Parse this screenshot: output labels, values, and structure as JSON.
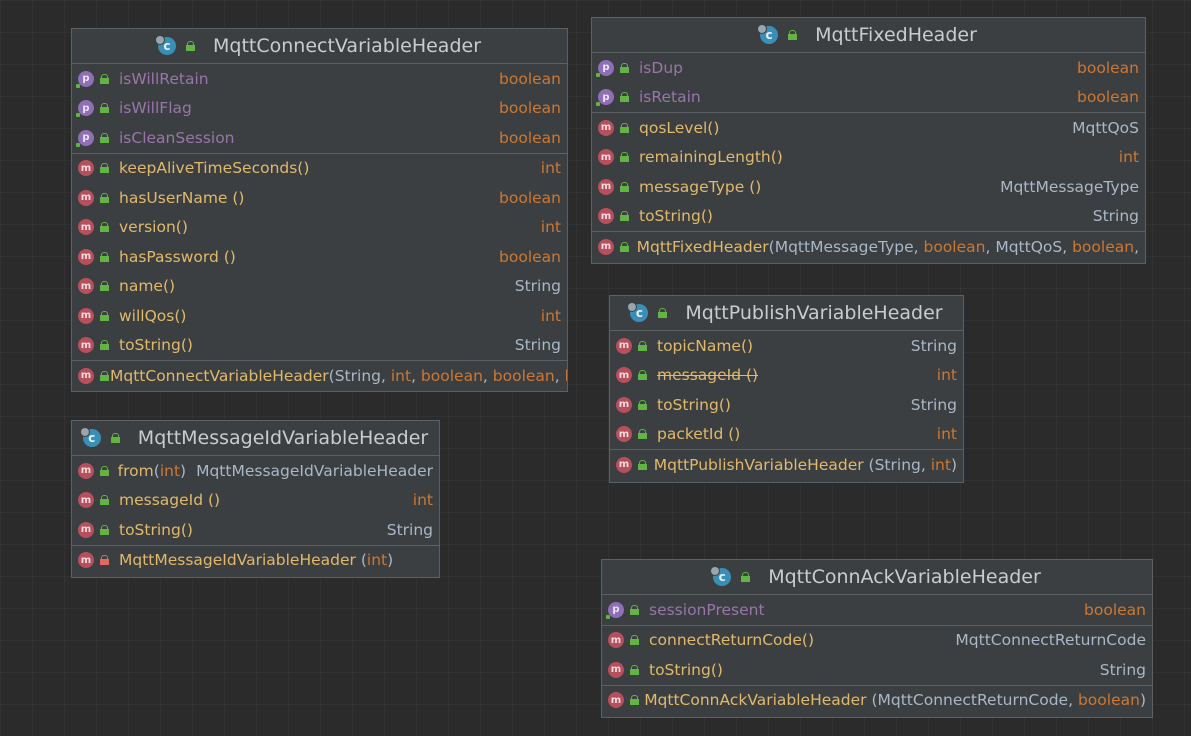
{
  "classes": {
    "connect": {
      "name": "MqttConnectVariableHeader",
      "fields": [
        {
          "name": "isWillRetain",
          "type": "boolean"
        },
        {
          "name": "isWillFlag",
          "type": "boolean"
        },
        {
          "name": "isCleanSession",
          "type": "boolean"
        }
      ],
      "methods": [
        {
          "name": "keepAliveTimeSeconds()",
          "type": "int"
        },
        {
          "name": "hasUserName ()",
          "type": "boolean"
        },
        {
          "name": "version()",
          "type": "int"
        },
        {
          "name": "hasPassword ()",
          "type": "boolean"
        },
        {
          "name": "name()",
          "type": "String"
        },
        {
          "name": "willQos()",
          "type": "int"
        },
        {
          "name": "toString()",
          "type": "String"
        }
      ],
      "ctor": {
        "name": "MqttConnectVariableHeader",
        "params": [
          "String",
          "int",
          "boolean",
          "boolean",
          "b"
        ]
      }
    },
    "fixed": {
      "name": "MqttFixedHeader",
      "fields": [
        {
          "name": "isDup",
          "type": "boolean"
        },
        {
          "name": "isRetain",
          "type": "boolean"
        }
      ],
      "methods": [
        {
          "name": "qosLevel()",
          "type": "MqttQoS"
        },
        {
          "name": "remainingLength()",
          "type": "int"
        },
        {
          "name": "messageType ()",
          "type": "MqttMessageType"
        },
        {
          "name": "toString()",
          "type": "String"
        }
      ],
      "ctor": {
        "name": "MqttFixedHeader",
        "params": [
          "MqttMessageType",
          "boolean",
          "MqttQoS",
          "boolean"
        ]
      }
    },
    "publish": {
      "name": "MqttPublishVariableHeader",
      "methods": [
        {
          "name": "topicName()",
          "type": "String"
        },
        {
          "name": "messageId ()",
          "type": "int"
        },
        {
          "name": "toString()",
          "type": "String"
        },
        {
          "name": "packetId ()",
          "type": "int"
        }
      ],
      "ctor": {
        "name": "MqttPublishVariableHeader",
        "params": [
          "String",
          "int"
        ]
      }
    },
    "messageId": {
      "name": "MqttMessageIdVariableHeader",
      "methods": [
        {
          "name": "from",
          "arg": "int",
          "type": "MqttMessageIdVariableHeader"
        },
        {
          "name": "messageId ()",
          "type": "int"
        },
        {
          "name": "toString()",
          "type": "String"
        }
      ],
      "ctor": {
        "name": "MqttMessageIdVariableHeader",
        "params": [
          "int"
        ]
      }
    },
    "connAck": {
      "name": "MqttConnAckVariableHeader",
      "fields": [
        {
          "name": "sessionPresent",
          "type": "boolean"
        }
      ],
      "methods": [
        {
          "name": "connectReturnCode()",
          "type": "MqttConnectReturnCode"
        },
        {
          "name": "toString()",
          "type": "String"
        }
      ],
      "ctor": {
        "name": "MqttConnAckVariableHeader",
        "params": [
          "MqttConnectReturnCode",
          "boolean"
        ]
      }
    }
  },
  "icons": {
    "method": "m",
    "property": "p",
    "class": "c"
  },
  "colors": {
    "background": "#2b2b2b",
    "node": "#3c3f41",
    "method_name": "#e0b96a",
    "keyword_type": "#cc7832",
    "class_type": "#a9b7c6",
    "property": "#9876aa"
  }
}
